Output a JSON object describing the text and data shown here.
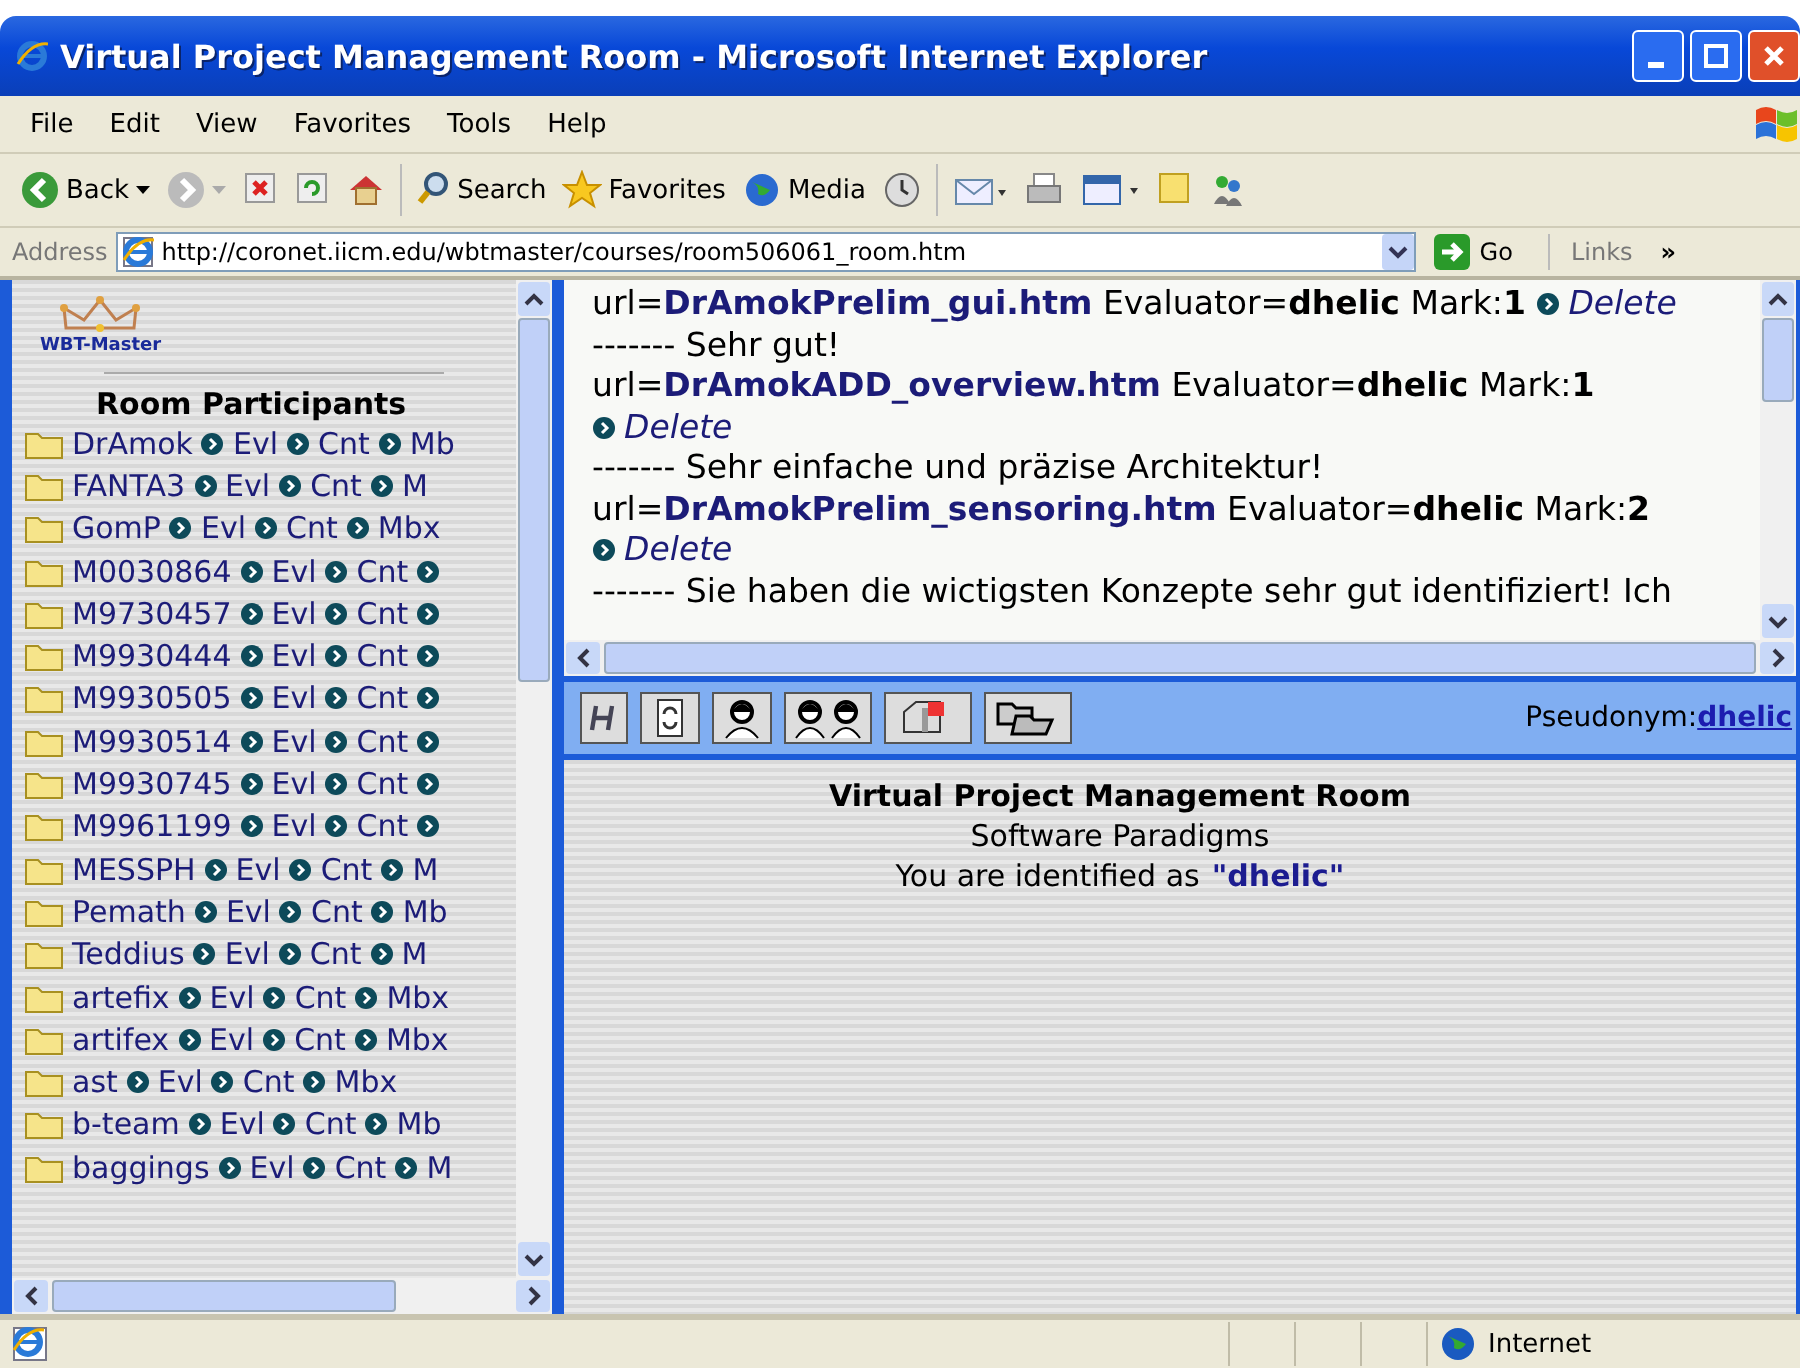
{
  "window": {
    "title": "Virtual Project Management Room - Microsoft Internet Explorer"
  },
  "menu": [
    "File",
    "Edit",
    "View",
    "Favorites",
    "Tools",
    "Help"
  ],
  "toolbar": [
    {
      "kind": "back",
      "label": "Back"
    },
    {
      "kind": "forward"
    },
    {
      "kind": "stop"
    },
    {
      "kind": "refresh"
    },
    {
      "kind": "home"
    },
    {
      "kind": "search",
      "label": "Search"
    },
    {
      "kind": "favorites",
      "label": "Favorites"
    },
    {
      "kind": "media",
      "label": "Media"
    },
    {
      "kind": "history"
    },
    {
      "kind": "mail"
    },
    {
      "kind": "print"
    },
    {
      "kind": "edit"
    },
    {
      "kind": "note"
    },
    {
      "kind": "messenger"
    }
  ],
  "address_bar": {
    "label": "Address",
    "url": "http://coronet.iicm.edu/wbtmaster/courses/room506061_room.htm",
    "go": "Go",
    "links": "Links",
    "more": "»"
  },
  "sidebar": {
    "logo": "WBT-Master",
    "heading": "Room Participants",
    "participants": [
      {
        "name": "DrAmok",
        "links": [
          "Evl",
          "Cnt",
          "Mb"
        ],
        "more": false
      },
      {
        "name": "FANTA3",
        "links": [
          "Evl",
          "Cnt",
          "M"
        ],
        "more": false
      },
      {
        "name": "GomP",
        "links": [
          "Evl",
          "Cnt",
          "Mbx"
        ],
        "more": false
      },
      {
        "name": "M0030864",
        "links": [
          "Evl",
          "Cnt"
        ],
        "more": true
      },
      {
        "name": "M9730457",
        "links": [
          "Evl",
          "Cnt"
        ],
        "more": true
      },
      {
        "name": "M9930444",
        "links": [
          "Evl",
          "Cnt"
        ],
        "more": true
      },
      {
        "name": "M9930505",
        "links": [
          "Evl",
          "Cnt"
        ],
        "more": true
      },
      {
        "name": "M9930514",
        "links": [
          "Evl",
          "Cnt"
        ],
        "more": true
      },
      {
        "name": "M9930745",
        "links": [
          "Evl",
          "Cnt"
        ],
        "more": true
      },
      {
        "name": "M9961199",
        "links": [
          "Evl",
          "Cnt"
        ],
        "more": true
      },
      {
        "name": "MESSPH",
        "links": [
          "Evl",
          "Cnt",
          "M"
        ],
        "more": false
      },
      {
        "name": "Pemath",
        "links": [
          "Evl",
          "Cnt",
          "Mb"
        ],
        "more": false
      },
      {
        "name": "Teddius",
        "links": [
          "Evl",
          "Cnt",
          "M"
        ],
        "more": false
      },
      {
        "name": "artefix",
        "links": [
          "Evl",
          "Cnt",
          "Mbx"
        ],
        "more": false
      },
      {
        "name": "artifex",
        "links": [
          "Evl",
          "Cnt",
          "Mbx"
        ],
        "more": false
      },
      {
        "name": "ast",
        "links": [
          "Evl",
          "Cnt",
          "Mbx"
        ],
        "more": false
      },
      {
        "name": "b-team",
        "links": [
          "Evl",
          "Cnt",
          "Mb"
        ],
        "more": false
      },
      {
        "name": "baggings",
        "links": [
          "Evl",
          "Cnt",
          "M"
        ],
        "more": false
      }
    ]
  },
  "evaluations": [
    {
      "url_label": "url=",
      "url": "DrAmokPrelim_gui.htm",
      "evaluator_label": "Evaluator=",
      "evaluator": "dhelic",
      "mark_label": "Mark:",
      "mark": "1",
      "delete": "Delete",
      "comment": "------- Sehr gut!"
    },
    {
      "url_label": "url=",
      "url": "DrAmokADD_overview.htm",
      "evaluator_label": "Evaluator=",
      "evaluator": "dhelic",
      "mark_label": "Mark:",
      "mark": "1",
      "delete": "Delete",
      "comment": "------- Sehr einfache und präzise Architektur!"
    },
    {
      "url_label": "url=",
      "url": "DrAmokPrelim_sensoring.htm",
      "evaluator_label": "Evaluator=",
      "evaluator": "dhelic",
      "mark_label": "Mark:",
      "mark": "2",
      "delete": "Delete",
      "comment": "------- Sie haben die wictigsten Konzepte sehr gut identifiziert! Ich"
    }
  ],
  "room_toolbar": {
    "tools": [
      {
        "kind": "help"
      },
      {
        "kind": "refresh"
      },
      {
        "kind": "person"
      },
      {
        "kind": "people"
      },
      {
        "kind": "mailbox"
      },
      {
        "kind": "folders"
      }
    ],
    "pseudonym_label": "Pseudonym:",
    "pseudonym": "dhelic"
  },
  "info": {
    "title": "Virtual Project Management Room",
    "subtitle": "Software Paradigms",
    "identity_text": "You are identified as",
    "identity_name": "\"dhelic\""
  },
  "status_bar": {
    "zone": "Internet"
  }
}
